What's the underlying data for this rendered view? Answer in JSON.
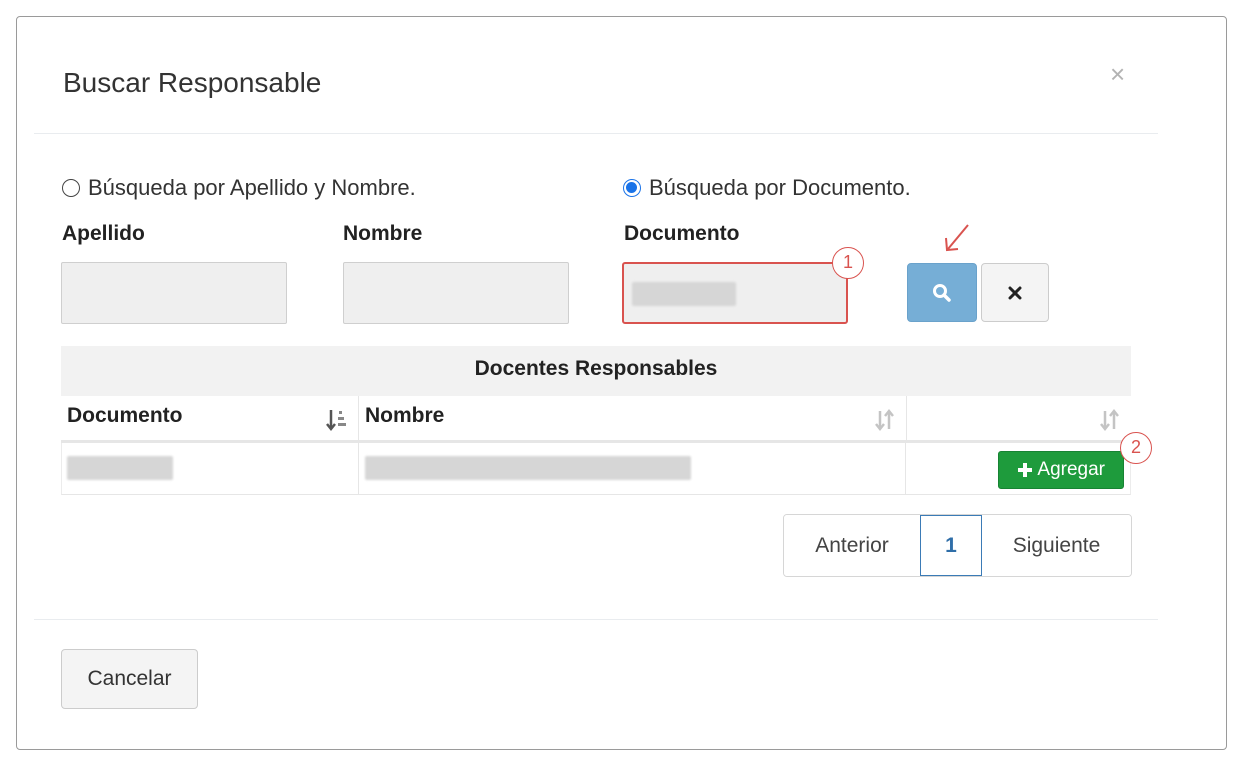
{
  "modal": {
    "title": "Buscar Responsable",
    "close_label": "×"
  },
  "search_mode": {
    "option_name": "Búsqueda por Apellido y Nombre.",
    "option_document": "Búsqueda por Documento.",
    "selected": "document"
  },
  "fields": {
    "apellido_label": "Apellido",
    "nombre_label": "Nombre",
    "documento_label": "Documento"
  },
  "annotations": {
    "badge_1": "1",
    "badge_2": "2",
    "annotation_color": "#d9534f"
  },
  "table": {
    "caption": "Docentes Responsables",
    "columns": [
      "Documento",
      "Nombre"
    ],
    "add_button_label": "Agregar"
  },
  "pagination": {
    "prev": "Anterior",
    "current": "1",
    "next": "Siguiente"
  },
  "footer": {
    "cancel_label": "Cancelar"
  },
  "colors": {
    "search_button": "#76aed6",
    "add_button": "#1e9b3c",
    "radio_checked": "#1a73e8",
    "pagination_active": "#3b7bb6"
  }
}
